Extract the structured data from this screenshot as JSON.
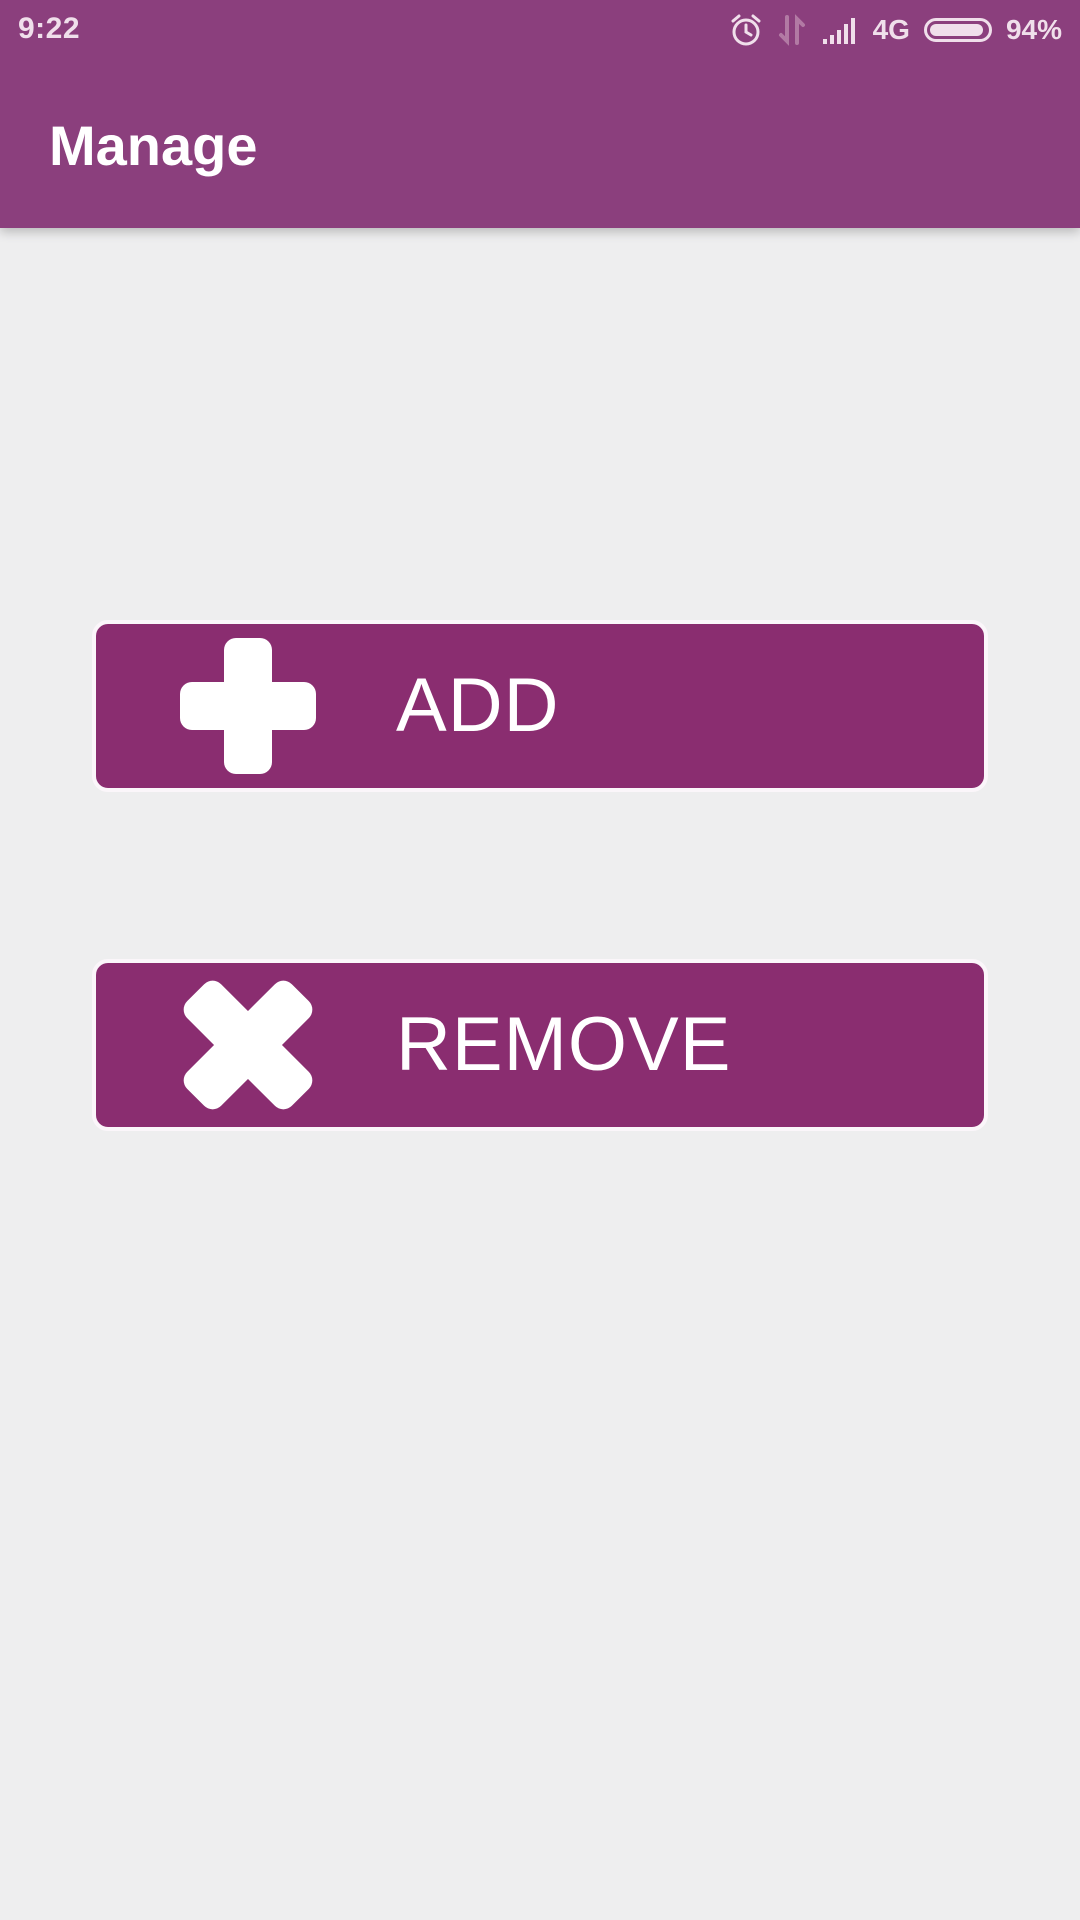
{
  "status_bar": {
    "time": "9:22",
    "network": "4G",
    "battery": "94%",
    "battery_level": 0.94,
    "icons": [
      "alarm-icon",
      "data-transfer-icon",
      "signal-icon",
      "battery-icon"
    ]
  },
  "app_bar": {
    "title": "Manage"
  },
  "actions": {
    "add": {
      "label": "ADD",
      "icon": "plus-icon"
    },
    "remove": {
      "label": "REMOVE",
      "icon": "x-icon"
    }
  },
  "colors": {
    "app_bar": "#8b3f7d",
    "button": "#8a2d70",
    "background": "#eeeeef",
    "text_on_primary": "#ffffff"
  }
}
